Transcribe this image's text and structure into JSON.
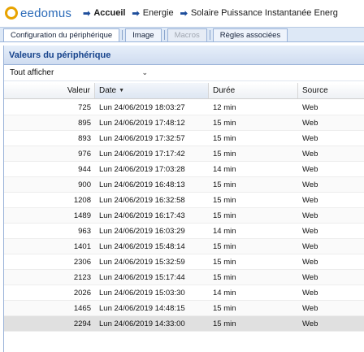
{
  "app": {
    "logo_text": "eedomus",
    "breadcrumbs": [
      {
        "label": "Accueil",
        "bold": true
      },
      {
        "label": "Energie",
        "bold": false
      },
      {
        "label": "Solaire Puissance Instantanée Energ",
        "bold": false
      }
    ]
  },
  "tabs": [
    {
      "label": "Configuration du périphérique",
      "state": "active"
    },
    {
      "label": "Image",
      "state": "normal"
    },
    {
      "label": "Macros",
      "state": "disabled"
    },
    {
      "label": "Règles associées",
      "state": "normal"
    }
  ],
  "panel": {
    "title": "Valeurs du périphérique",
    "filter_value": "Tout afficher"
  },
  "grid": {
    "columns": {
      "value": "Valeur",
      "date": "Date",
      "duration": "Durée",
      "source": "Source"
    },
    "rows": [
      {
        "value": "725",
        "date": "Lun 24/06/2019 18:03:27",
        "duration": "12 min",
        "source": "Web"
      },
      {
        "value": "895",
        "date": "Lun 24/06/2019 17:48:12",
        "duration": "15 min",
        "source": "Web"
      },
      {
        "value": "893",
        "date": "Lun 24/06/2019 17:32:57",
        "duration": "15 min",
        "source": "Web"
      },
      {
        "value": "976",
        "date": "Lun 24/06/2019 17:17:42",
        "duration": "15 min",
        "source": "Web"
      },
      {
        "value": "944",
        "date": "Lun 24/06/2019 17:03:28",
        "duration": "14 min",
        "source": "Web"
      },
      {
        "value": "900",
        "date": "Lun 24/06/2019 16:48:13",
        "duration": "15 min",
        "source": "Web"
      },
      {
        "value": "1208",
        "date": "Lun 24/06/2019 16:32:58",
        "duration": "15 min",
        "source": "Web"
      },
      {
        "value": "1489",
        "date": "Lun 24/06/2019 16:17:43",
        "duration": "15 min",
        "source": "Web"
      },
      {
        "value": "963",
        "date": "Lun 24/06/2019 16:03:29",
        "duration": "14 min",
        "source": "Web"
      },
      {
        "value": "1401",
        "date": "Lun 24/06/2019 15:48:14",
        "duration": "15 min",
        "source": "Web"
      },
      {
        "value": "2306",
        "date": "Lun 24/06/2019 15:32:59",
        "duration": "15 min",
        "source": "Web"
      },
      {
        "value": "2123",
        "date": "Lun 24/06/2019 15:17:44",
        "duration": "15 min",
        "source": "Web"
      },
      {
        "value": "2026",
        "date": "Lun 24/06/2019 15:03:30",
        "duration": "14 min",
        "source": "Web"
      },
      {
        "value": "1465",
        "date": "Lun 24/06/2019 14:48:15",
        "duration": "15 min",
        "source": "Web"
      },
      {
        "value": "2294",
        "date": "Lun 24/06/2019 14:33:00",
        "duration": "15 min",
        "source": "Web",
        "selected": true
      }
    ]
  },
  "colors": {
    "logo_ring": "#e8a300",
    "logo_text": "#2a6ab8",
    "panel_title": "#15428b"
  }
}
